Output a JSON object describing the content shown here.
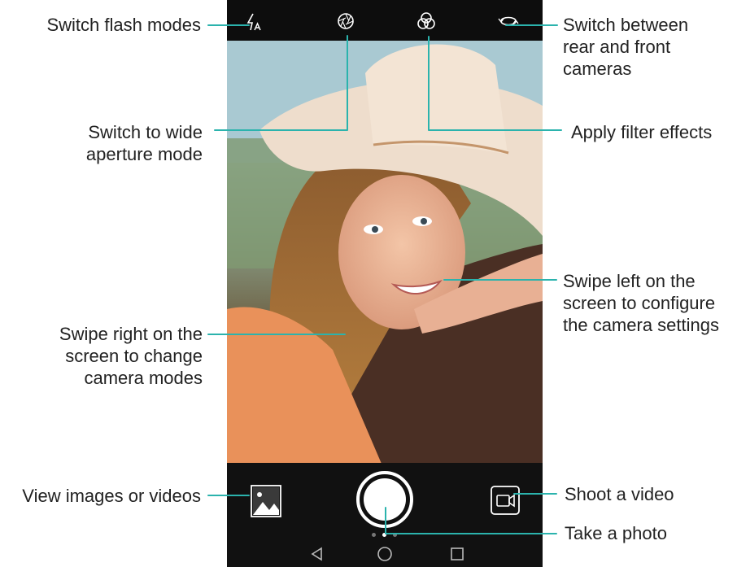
{
  "callouts": {
    "flash": "Switch flash modes",
    "aperture_line1": "Switch to wide",
    "aperture_line2": "aperture mode",
    "switch_camera_line1": "Switch between",
    "switch_camera_line2": "rear and front",
    "switch_camera_line3": "cameras",
    "filter": "Apply filter effects",
    "swipe_left_line1": "Swipe left on the",
    "swipe_left_line2": "screen to configure",
    "swipe_left_line3": "the camera settings",
    "swipe_right_line1": "Swipe right on the",
    "swipe_right_line2": "screen to change",
    "swipe_right_line3": "camera modes",
    "gallery": "View images or videos",
    "video": "Shoot a video",
    "photo": "Take a photo"
  },
  "icons": {
    "flash": "flash-auto-icon",
    "aperture": "aperture-icon",
    "filter": "filter-icon",
    "switch_camera": "switch-camera-icon",
    "gallery": "gallery-icon",
    "shutter": "shutter-button",
    "video": "video-camera-icon",
    "back": "back-nav-icon",
    "home": "home-nav-icon",
    "recents": "recents-nav-icon"
  },
  "colors": {
    "leader_line": "#2bb3ad",
    "phone_bg": "#000000",
    "icon": "#ffffff"
  }
}
